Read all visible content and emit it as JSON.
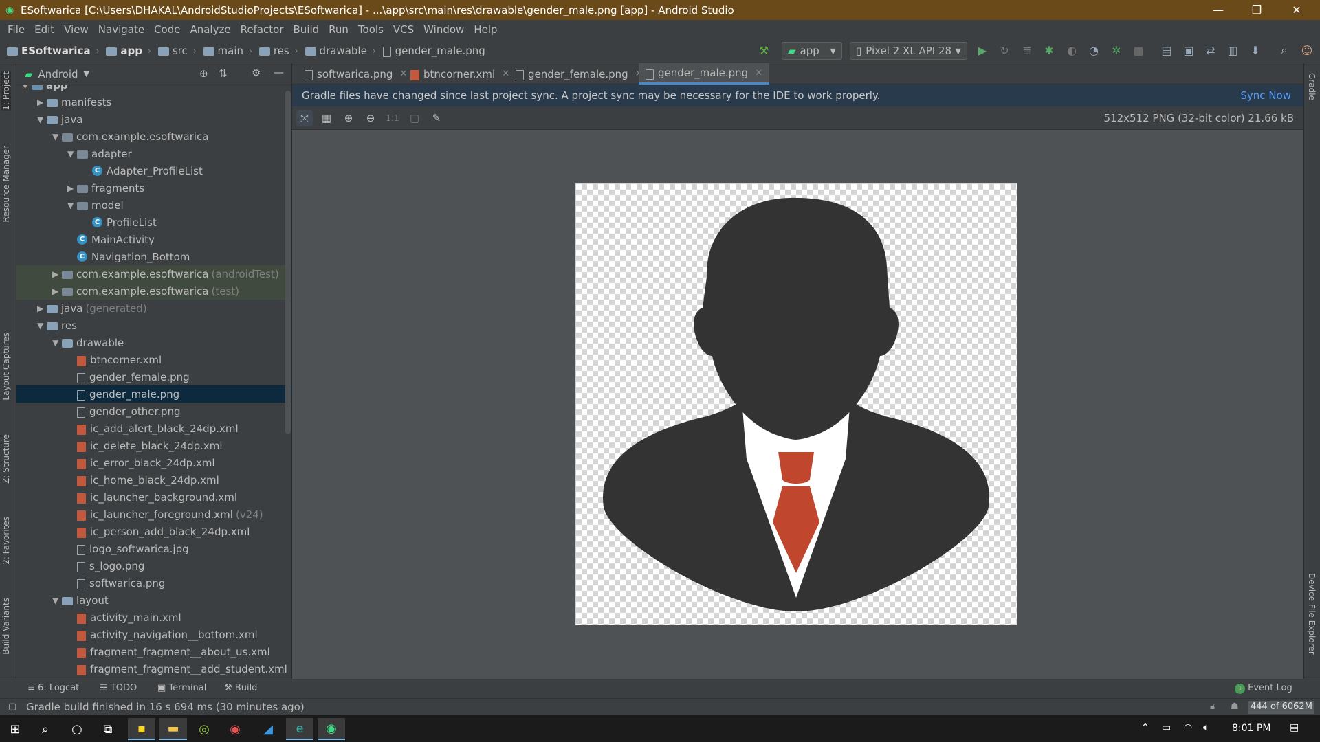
{
  "window": {
    "title": "ESoftwarica [C:\\Users\\DHAKAL\\AndroidStudioProjects\\ESoftwarica] - ...\\app\\src\\main\\res\\drawable\\gender_male.png [app] - Android Studio"
  },
  "menu": [
    "File",
    "Edit",
    "View",
    "Navigate",
    "Code",
    "Analyze",
    "Refactor",
    "Build",
    "Run",
    "Tools",
    "VCS",
    "Window",
    "Help"
  ],
  "breadcrumb": [
    "ESoftwarica",
    "app",
    "src",
    "main",
    "res",
    "drawable",
    "gender_male.png"
  ],
  "toolbar": {
    "config": "app",
    "device": "Pixel 2 XL API 28"
  },
  "left_tool_windows": [
    "1: Project",
    "Resource Manager",
    "Layout Captures",
    "Z: Structure",
    "2: Favorites",
    "Build Variants"
  ],
  "right_tool_windows": [
    "Gradle",
    "Device File Explorer"
  ],
  "project_panel": {
    "view": "Android",
    "tree": [
      {
        "text": "app",
        "dim": "",
        "depth": 0,
        "icon": "module-folder-icon",
        "arrow": "▼"
      },
      {
        "text": "manifests",
        "dim": "",
        "depth": 1,
        "icon": "folder-icon",
        "arrow": "▶"
      },
      {
        "text": "java",
        "dim": "",
        "depth": 1,
        "icon": "folder-icon",
        "arrow": "▼"
      },
      {
        "text": "com.example.esoftwarica",
        "dim": "",
        "depth": 2,
        "icon": "package-icon",
        "arrow": "▼"
      },
      {
        "text": "adapter",
        "dim": "",
        "depth": 3,
        "icon": "package-icon",
        "arrow": "▼"
      },
      {
        "text": "Adapter_ProfileList",
        "dim": "",
        "depth": 4,
        "icon": "class-icon",
        "arrow": ""
      },
      {
        "text": "fragments",
        "dim": "",
        "depth": 3,
        "icon": "package-icon",
        "arrow": "▶"
      },
      {
        "text": "model",
        "dim": "",
        "depth": 3,
        "icon": "package-icon",
        "arrow": "▼"
      },
      {
        "text": "ProfileList",
        "dim": "",
        "depth": 4,
        "icon": "class-icon",
        "arrow": ""
      },
      {
        "text": "MainActivity",
        "dim": "",
        "depth": 3,
        "icon": "class-icon",
        "arrow": ""
      },
      {
        "text": "Navigation_Bottom",
        "dim": "",
        "depth": 3,
        "icon": "class-icon",
        "arrow": ""
      },
      {
        "text": "com.example.esoftwarica",
        "dim": "(androidTest)",
        "depth": 2,
        "icon": "package-icon",
        "arrow": "▶",
        "hl": true
      },
      {
        "text": "com.example.esoftwarica",
        "dim": "(test)",
        "depth": 2,
        "icon": "package-icon",
        "arrow": "▶",
        "hl": true
      },
      {
        "text": "java",
        "dim": "(generated)",
        "depth": 1,
        "icon": "generated-folder-icon",
        "arrow": "▶"
      },
      {
        "text": "res",
        "dim": "",
        "depth": 1,
        "icon": "res-folder-icon",
        "arrow": "▼"
      },
      {
        "text": "drawable",
        "dim": "",
        "depth": 2,
        "icon": "folder-icon",
        "arrow": "▼"
      },
      {
        "text": "btncorner.xml",
        "dim": "",
        "depth": 3,
        "icon": "xml-file-icon",
        "arrow": ""
      },
      {
        "text": "gender_female.png",
        "dim": "",
        "depth": 3,
        "icon": "image-file-icon",
        "arrow": ""
      },
      {
        "text": "gender_male.png",
        "dim": "",
        "depth": 3,
        "icon": "image-file-icon",
        "arrow": "",
        "sel": true
      },
      {
        "text": "gender_other.png",
        "dim": "",
        "depth": 3,
        "icon": "image-file-icon",
        "arrow": ""
      },
      {
        "text": "ic_add_alert_black_24dp.xml",
        "dim": "",
        "depth": 3,
        "icon": "xml-file-icon",
        "arrow": ""
      },
      {
        "text": "ic_delete_black_24dp.xml",
        "dim": "",
        "depth": 3,
        "icon": "xml-file-icon",
        "arrow": ""
      },
      {
        "text": "ic_error_black_24dp.xml",
        "dim": "",
        "depth": 3,
        "icon": "xml-file-icon",
        "arrow": ""
      },
      {
        "text": "ic_home_black_24dp.xml",
        "dim": "",
        "depth": 3,
        "icon": "xml-file-icon",
        "arrow": ""
      },
      {
        "text": "ic_launcher_background.xml",
        "dim": "",
        "depth": 3,
        "icon": "xml-file-icon",
        "arrow": ""
      },
      {
        "text": "ic_launcher_foreground.xml",
        "dim": "(v24)",
        "depth": 3,
        "icon": "xml-file-icon",
        "arrow": ""
      },
      {
        "text": "ic_person_add_black_24dp.xml",
        "dim": "",
        "depth": 3,
        "icon": "xml-file-icon",
        "arrow": ""
      },
      {
        "text": "logo_softwarica.jpg",
        "dim": "",
        "depth": 3,
        "icon": "image-file-icon",
        "arrow": ""
      },
      {
        "text": "s_logo.png",
        "dim": "",
        "depth": 3,
        "icon": "image-file-icon",
        "arrow": ""
      },
      {
        "text": "softwarica.png",
        "dim": "",
        "depth": 3,
        "icon": "image-file-icon",
        "arrow": ""
      },
      {
        "text": "layout",
        "dim": "",
        "depth": 2,
        "icon": "folder-icon",
        "arrow": "▼"
      },
      {
        "text": "activity_main.xml",
        "dim": "",
        "depth": 3,
        "icon": "xml-file-icon",
        "arrow": ""
      },
      {
        "text": "activity_navigation__bottom.xml",
        "dim": "",
        "depth": 3,
        "icon": "xml-file-icon",
        "arrow": ""
      },
      {
        "text": "fragment_fragment__about_us.xml",
        "dim": "",
        "depth": 3,
        "icon": "xml-file-icon",
        "arrow": ""
      },
      {
        "text": "fragment_fragment__add_student.xml",
        "dim": "",
        "depth": 3,
        "icon": "xml-file-icon",
        "arrow": ""
      }
    ]
  },
  "editor_tabs": [
    {
      "label": "softwarica.png",
      "icon": "image-file-icon",
      "active": false
    },
    {
      "label": "btncorner.xml",
      "icon": "xml-file-icon",
      "active": false
    },
    {
      "label": "gender_female.png",
      "icon": "image-file-icon",
      "active": false
    },
    {
      "label": "gender_male.png",
      "icon": "image-file-icon",
      "active": true
    }
  ],
  "banner": {
    "message": "Gradle files have changed since last project sync. A project sync may be necessary for the IDE to work properly.",
    "action": "Sync Now"
  },
  "image_toolbar": {
    "zoom_label": "1:1"
  },
  "image_info": "512x512 PNG (32-bit color) 21.66 kB",
  "bottom_tools": {
    "logcat": "6: Logcat",
    "todo": "TODO",
    "terminal": "Terminal",
    "build": "Build",
    "event_log": "Event Log",
    "event_count": "1"
  },
  "status": {
    "message": "Gradle build finished in 16 s 694 ms (30 minutes ago)",
    "memory": "444 of 6062M"
  },
  "taskbar": {
    "time": "8:01 PM"
  },
  "colors": {
    "accent": "#4a88c7",
    "title_bar": "#6b4a1a",
    "tie": "#c0472e",
    "silhouette": "#333333",
    "link": "#589df6"
  }
}
